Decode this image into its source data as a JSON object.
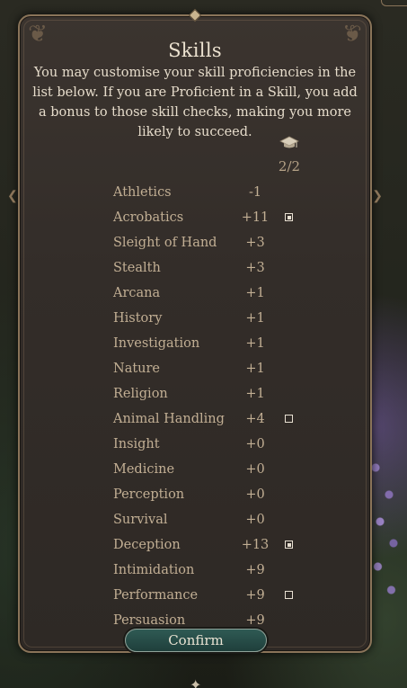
{
  "panel": {
    "title": "Skills",
    "description": "You may customise your skill proficiencies in the list below. If you are Proficient in a Skill, you add a bonus to those skill checks, making you more likely to succeed.",
    "proficiency_icon": "graduation-cap-icon",
    "proficiency_counter": "2/2"
  },
  "skills": [
    {
      "name": "Athletics",
      "bonus": "-1",
      "proficiency": "none"
    },
    {
      "name": "Acrobatics",
      "bonus": "+11",
      "proficiency": "checked"
    },
    {
      "name": "Sleight of Hand",
      "bonus": "+3",
      "proficiency": "none"
    },
    {
      "name": "Stealth",
      "bonus": "+3",
      "proficiency": "none"
    },
    {
      "name": "Arcana",
      "bonus": "+1",
      "proficiency": "none"
    },
    {
      "name": "History",
      "bonus": "+1",
      "proficiency": "none"
    },
    {
      "name": "Investigation",
      "bonus": "+1",
      "proficiency": "none"
    },
    {
      "name": "Nature",
      "bonus": "+1",
      "proficiency": "none"
    },
    {
      "name": "Religion",
      "bonus": "+1",
      "proficiency": "none"
    },
    {
      "name": "Animal Handling",
      "bonus": "+4",
      "proficiency": "unchecked"
    },
    {
      "name": "Insight",
      "bonus": "+0",
      "proficiency": "none"
    },
    {
      "name": "Medicine",
      "bonus": "+0",
      "proficiency": "none"
    },
    {
      "name": "Perception",
      "bonus": "+0",
      "proficiency": "none"
    },
    {
      "name": "Survival",
      "bonus": "+0",
      "proficiency": "none"
    },
    {
      "name": "Deception",
      "bonus": "+13",
      "proficiency": "checked"
    },
    {
      "name": "Intimidation",
      "bonus": "+9",
      "proficiency": "none"
    },
    {
      "name": "Performance",
      "bonus": "+9",
      "proficiency": "unchecked"
    },
    {
      "name": "Persuasion",
      "bonus": "+9",
      "proficiency": "none"
    }
  ],
  "confirm_button": {
    "label": "Confirm"
  },
  "colors": {
    "panel_bg": "#352f2a",
    "frame": "#8a7459",
    "title_text": "#ece2d0",
    "skill_text": "#c2af94",
    "confirm_bg": "#2a4f4a"
  }
}
